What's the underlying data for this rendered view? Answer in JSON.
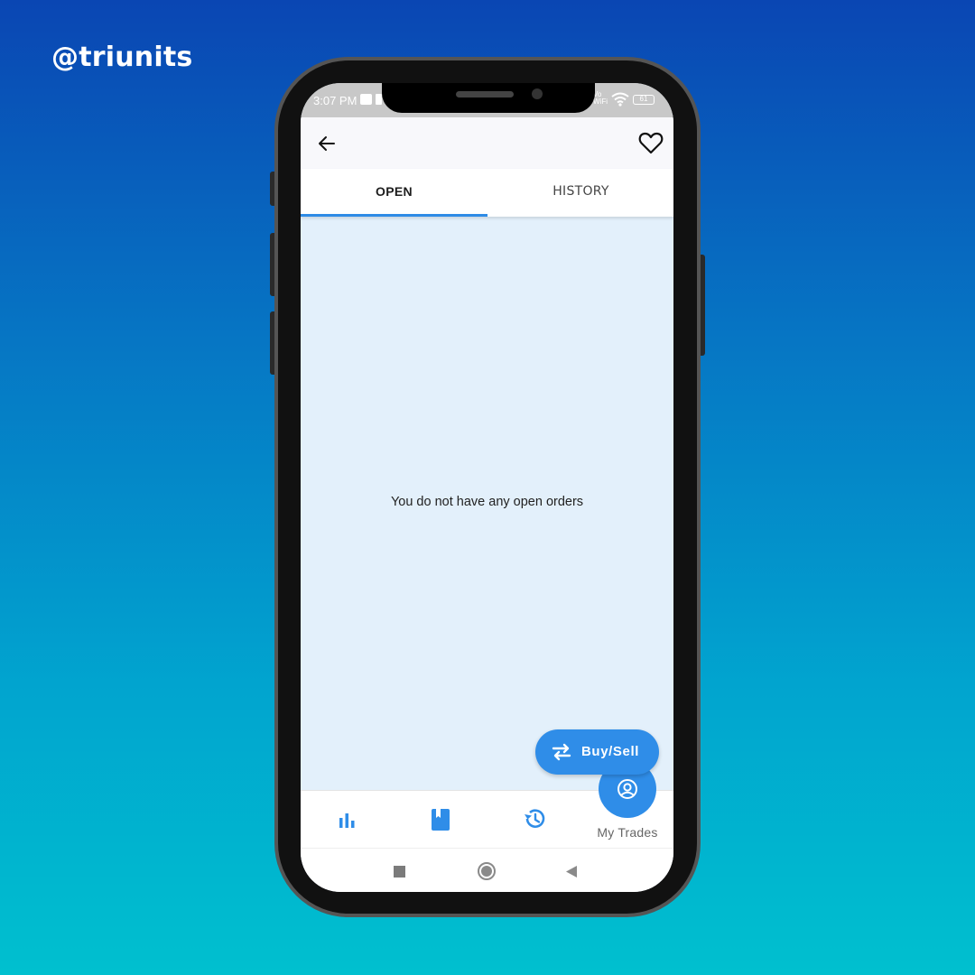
{
  "watermark": {
    "handle": "@triunits"
  },
  "statusbar": {
    "time": "3:07 PM",
    "network": "Vo\nWiFi",
    "battery": "61"
  },
  "appbar": {
    "back_icon": "arrow-left-icon",
    "favorite_icon": "heart-outline-icon"
  },
  "tabs": [
    {
      "label": "OPEN",
      "selected": true
    },
    {
      "label": "HISTORY",
      "selected": false
    }
  ],
  "main": {
    "empty_message": "You do not have any open orders"
  },
  "fab": {
    "label": "Buy/Sell",
    "icon": "swap-arrows-icon"
  },
  "bottom_nav": {
    "items": [
      {
        "icon": "bar-chart-icon"
      },
      {
        "icon": "book-icon"
      },
      {
        "icon": "history-clock-icon"
      },
      {
        "icon": "account-circle-icon",
        "label": "My Trades",
        "active": true
      }
    ]
  },
  "colors": {
    "accent": "#2f8de8",
    "content_bg": "#e3f0fb"
  }
}
